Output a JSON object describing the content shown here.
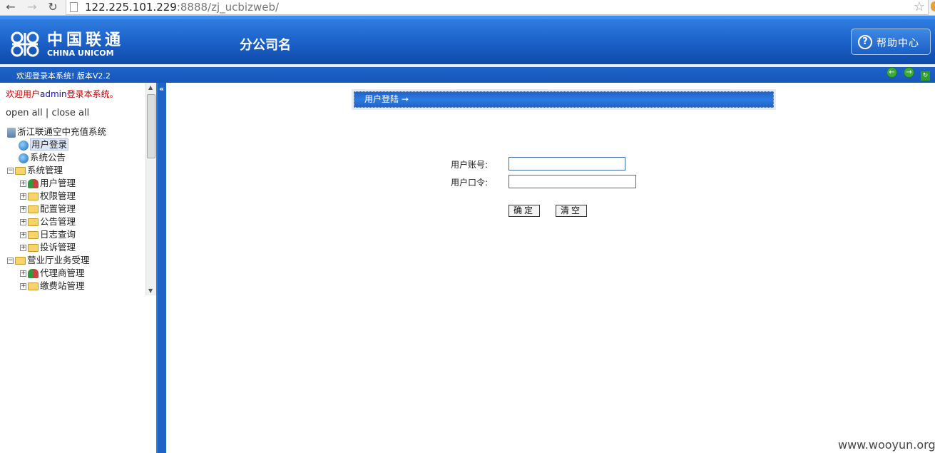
{
  "browser": {
    "url_host": "122.225.101.229",
    "url_rest": ":8888/zj_ucbizweb/"
  },
  "banner": {
    "logo_cn": "中国联通",
    "logo_en": "CHINA UNICOM",
    "company_name": "分公司名",
    "help_label": "帮助中心"
  },
  "strip": {
    "welcome": "欢迎登录本系统!  版本V2.2"
  },
  "sidebar": {
    "welcome_prefix": "欢迎用户",
    "username": "admin",
    "welcome_suffix": "登录本系统。",
    "open_all": "open all",
    "separator": "|",
    "close_all": "close all",
    "root": "浙江联通空中充值系统",
    "items": [
      {
        "label": "用户登录"
      },
      {
        "label": "系统公告"
      },
      {
        "label": "系统管理"
      },
      {
        "label": "用户管理"
      },
      {
        "label": "权限管理"
      },
      {
        "label": "配置管理"
      },
      {
        "label": "公告管理"
      },
      {
        "label": "日志查询"
      },
      {
        "label": "投诉管理"
      },
      {
        "label": "营业厅业务受理"
      },
      {
        "label": "代理商管理"
      },
      {
        "label": "缴费站管理"
      }
    ]
  },
  "main": {
    "title": "用户登陆  →",
    "account_label": "用户账号:",
    "password_label": "用户口令:",
    "account_value": "",
    "password_value": "",
    "confirm_label": "确定",
    "clear_label": "清空"
  },
  "watermark": "www.wooyun.org"
}
